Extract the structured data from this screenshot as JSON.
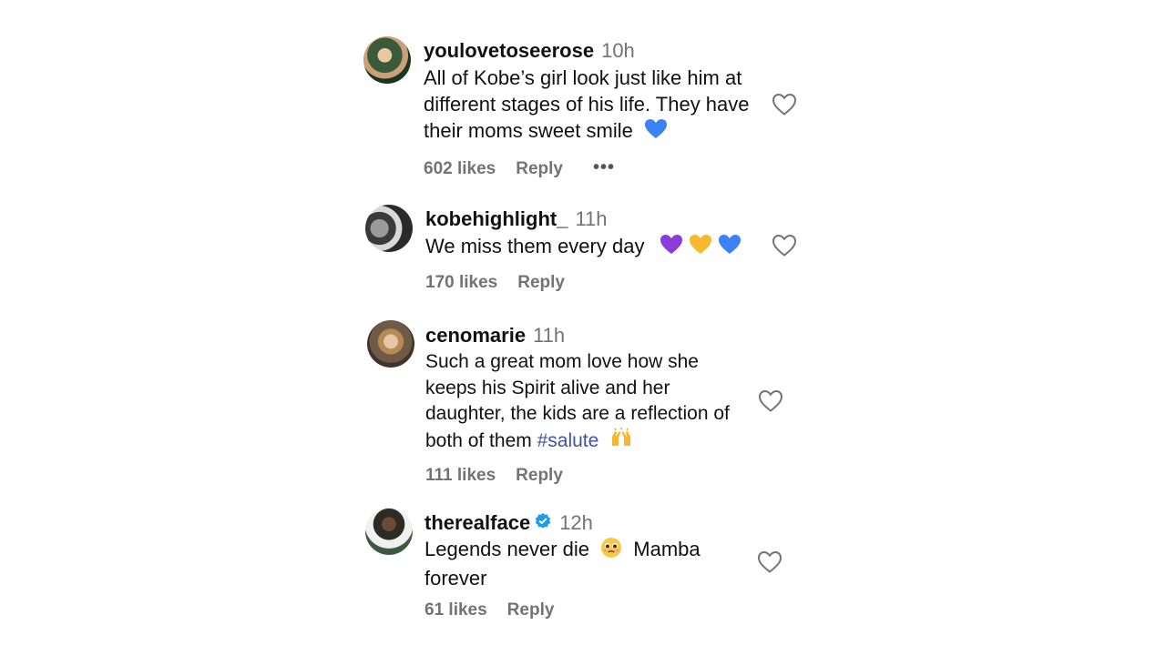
{
  "comments": [
    {
      "username": "youlovetoseerose",
      "time": "10h",
      "text": "All of Kobe’s girl look just like him at different stages of his life. They have their moms sweet smile",
      "emoji": "blue-heart",
      "likes": "602 likes",
      "reply": "Reply",
      "more": "•••"
    },
    {
      "username": "kobehighlight_",
      "time": "11h",
      "text": "We miss them every day",
      "emoji": "purple-heart, yellow-heart, blue-heart",
      "likes": "170 likes",
      "reply": "Reply"
    },
    {
      "username": "cenomarie",
      "time": "11h",
      "text": "Such a great mom love how she keeps his Spirit alive and her daughter, the kids are a reflection of both of them",
      "hashtag": "#salute",
      "emoji": "raised-hands",
      "likes": "111 likes",
      "reply": "Reply"
    },
    {
      "username": "therealface",
      "verified": true,
      "time": "12h",
      "text_before": "Legends never die",
      "text_after": "Mamba forever",
      "emoji": "pleading-face",
      "likes": "61 likes",
      "reply": "Reply"
    }
  ],
  "colors": {
    "text": "#111111",
    "muted": "#737373",
    "hashtag": "#4150a8",
    "verified": "#1d9bf0"
  }
}
